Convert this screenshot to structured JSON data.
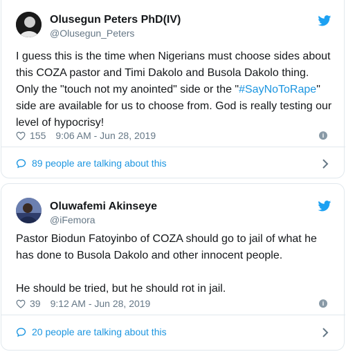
{
  "colors": {
    "accent": "#1b95e0",
    "muted": "#657786",
    "border": "#e1e8ed"
  },
  "tweets": [
    {
      "name": "Olusegun Peters PhD(IV)",
      "handle": "@Olusegun_Peters",
      "body_lines": [
        "I guess this is the time when Nigerians must choose sides about",
        "this COZA pastor and Timi Dakolo and Busola Dakolo thing.",
        "Only the \"touch not my anointed\" side or the \"",
        "\" side are available for us to choose from. God is really testing our",
        "level of hypocrisy!"
      ],
      "hashtag": "#SayNoToRape",
      "likes": "155",
      "time": "9:06 AM - Jun 28, 2019",
      "talking": "89 people are talking about this",
      "icons": [
        "twitter-bird-icon",
        "heart-icon",
        "info-icon",
        "comment-icon",
        "chevron-right-icon"
      ]
    },
    {
      "name": "Oluwafemi Akinseye",
      "handle": "@iFemora",
      "body_lines": [
        "Pastor Biodun Fatoyinbo of COZA should go to jail of what he",
        "has done to Busola Dakolo and other innocent people.",
        "",
        "He should be tried, but he should rot in jail."
      ],
      "likes": "39",
      "time": "9:12 AM - Jun 28, 2019",
      "talking": "20 people are talking about this",
      "icons": [
        "twitter-bird-icon",
        "heart-icon",
        "info-icon",
        "comment-icon",
        "chevron-right-icon"
      ]
    }
  ]
}
